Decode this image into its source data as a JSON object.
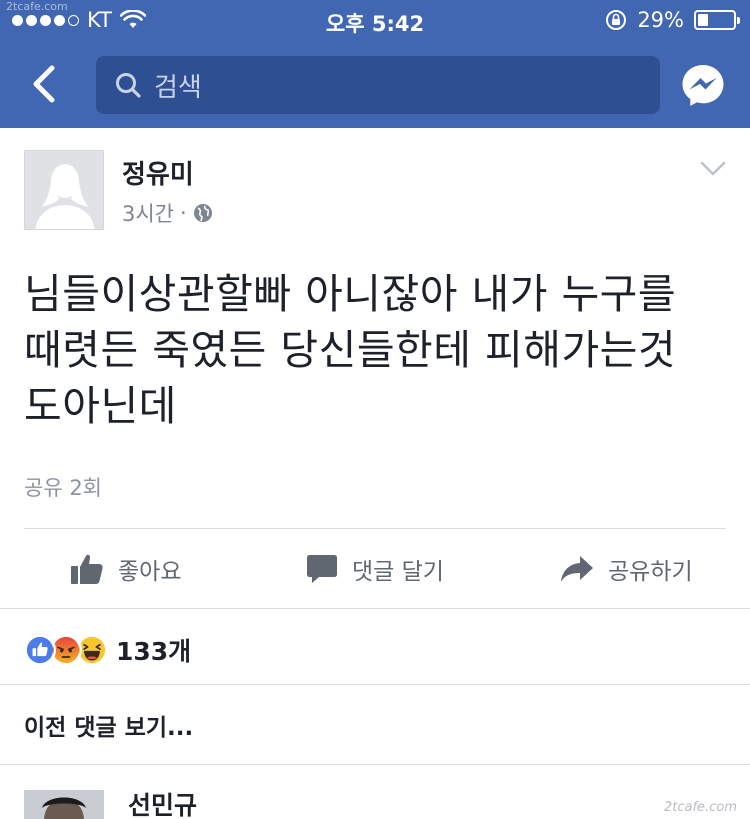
{
  "status_bar": {
    "carrier": "KT",
    "time": "오후 5:42",
    "battery": "29%",
    "signal_bars_filled": 4,
    "battery_level": 0.29
  },
  "watermark_top": "2tcafe.com",
  "nav": {
    "search_placeholder": "검색"
  },
  "post": {
    "author": "정유미",
    "time_ago": "3시간",
    "text_lines": [
      "님들이상관할빠 아니잖아 내가 누구를",
      "때렷든 죽였든 당신들한테 피해가는것",
      "도아닌데"
    ],
    "shares": "공유 2회"
  },
  "actions": {
    "like": "좋아요",
    "comment": "댓글 달기",
    "share": "공유하기"
  },
  "reactions": {
    "count": "133개",
    "types": [
      "like",
      "angry",
      "haha"
    ]
  },
  "comments": {
    "view_previous": "이전 댓글 보기...",
    "first_author": "선민규"
  },
  "watermark_bottom": "2tcafe.com",
  "colors": {
    "facebook_blue": "#4267b2",
    "search_bg": "#2f4f93",
    "text_primary": "#1d2129",
    "text_secondary": "#606770"
  }
}
